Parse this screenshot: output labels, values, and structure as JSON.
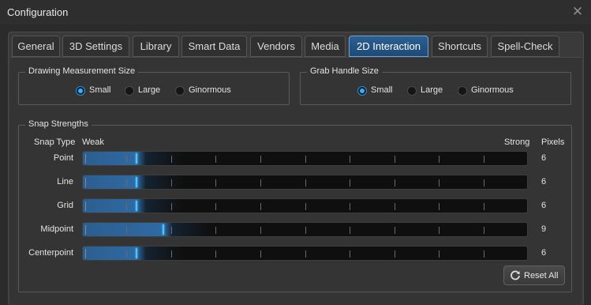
{
  "window": {
    "title": "Configuration",
    "close_glyph": "✕"
  },
  "tabs": [
    {
      "label": "General",
      "active": false
    },
    {
      "label": "3D Settings",
      "active": false
    },
    {
      "label": "Library",
      "active": false
    },
    {
      "label": "Smart Data",
      "active": false
    },
    {
      "label": "Vendors",
      "active": false
    },
    {
      "label": "Media",
      "active": false
    },
    {
      "label": "2D Interaction",
      "active": true
    },
    {
      "label": "Shortcuts",
      "active": false
    },
    {
      "label": "Spell-Check",
      "active": false
    }
  ],
  "drawing_measurement": {
    "label": "Drawing Measurement Size",
    "options": [
      "Small",
      "Large",
      "Ginormous"
    ],
    "selected": "Small"
  },
  "grab_handle": {
    "label": "Grab Handle Size",
    "options": [
      "Small",
      "Large",
      "Ginormous"
    ],
    "selected": "Small"
  },
  "snap": {
    "label": "Snap Strengths",
    "headers": {
      "type": "Snap Type",
      "weak": "Weak",
      "strong": "Strong",
      "pixels": "Pixels"
    },
    "rows": [
      {
        "name": "Point",
        "value": 6,
        "pixels": "6"
      },
      {
        "name": "Line",
        "value": 6,
        "pixels": "6"
      },
      {
        "name": "Grid",
        "value": 6,
        "pixels": "6"
      },
      {
        "name": "Midpoint",
        "value": 9,
        "pixels": "9"
      },
      {
        "name": "Centerpoint",
        "value": 6,
        "pixels": "6"
      }
    ],
    "max": 50
  },
  "reset_button": {
    "label": "Reset All",
    "icon": "refresh-icon"
  },
  "colors": {
    "accent": "#39b0ff",
    "active_tab": "#2b5f93",
    "fill": "#2f6aa3"
  }
}
